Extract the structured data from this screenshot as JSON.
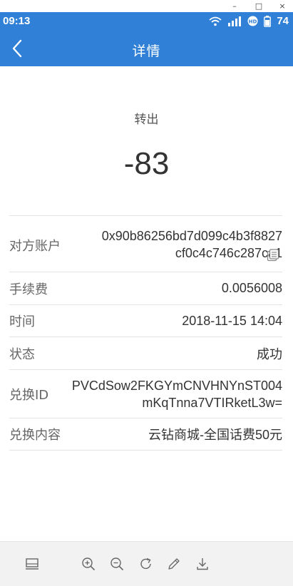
{
  "window_controls": {
    "minimize": "–",
    "maximize": "□",
    "close": "×"
  },
  "status_bar": {
    "time": "09:13",
    "battery": "74",
    "icons": [
      "wifi-icon",
      "signal-icon",
      "hd-icon",
      "battery-icon"
    ]
  },
  "header": {
    "title": "详情",
    "back_icon": "chevron-left-icon"
  },
  "summary": {
    "direction": "转出",
    "amount": "-83"
  },
  "details": {
    "account_label": "对方账户",
    "account_value_line1": "0x90b86256bd7d099c4b3f8827",
    "account_value_line2": "cf0c4c746c287ca1",
    "fee_label": "手续费",
    "fee_value": "0.0056008",
    "time_label": "时间",
    "time_value": "2018-11-15 14:04",
    "state_label": "状态",
    "state_value": "成功",
    "exchange_id_label": "兑换ID",
    "exchange_id_line1": "PVCdSow2FKGYmCNVHNYnST004",
    "exchange_id_line2": "mKqTnna7VTIRketL3w=",
    "content_label": "兑换内容",
    "content_value": "云钻商城-全国话费50元"
  },
  "toolbar": {
    "icons": [
      "screen-icon",
      "zoom-in-icon",
      "zoom-out-icon",
      "rotate-icon",
      "edit-icon",
      "download-icon"
    ]
  },
  "colors": {
    "primary": "#2f80d6",
    "divider": "#e3e3e3",
    "toolbar_bg": "#f2f2f2"
  }
}
